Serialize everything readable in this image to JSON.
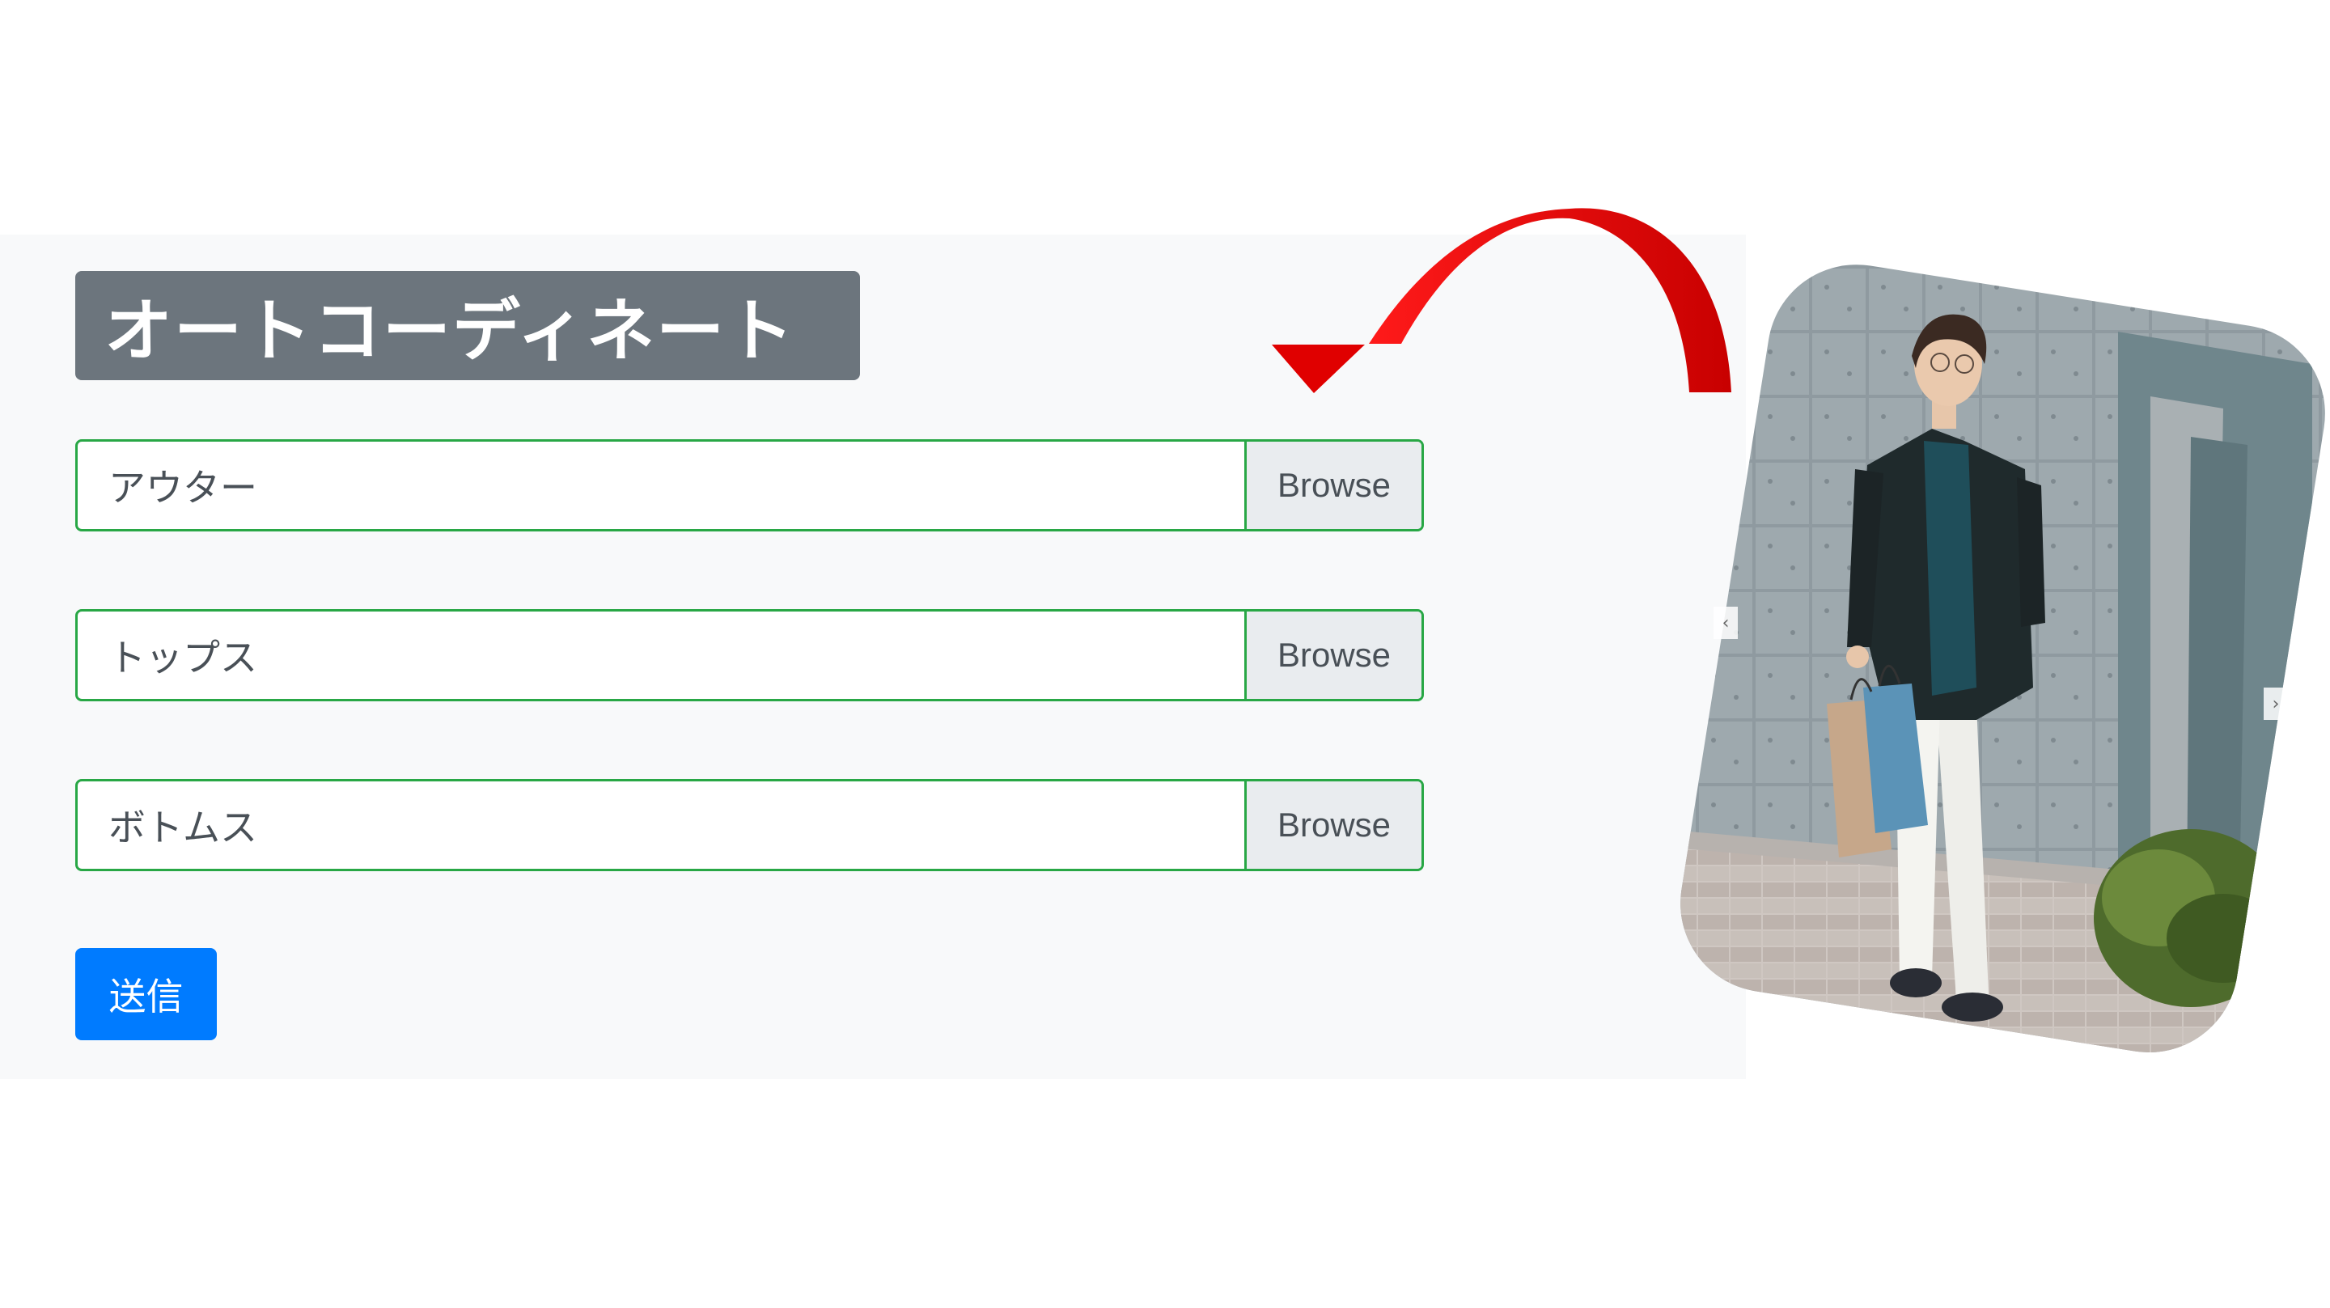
{
  "form": {
    "title": "オートコーディネート",
    "fields": [
      {
        "label": "アウター",
        "button": "Browse"
      },
      {
        "label": "トップス",
        "button": "Browse"
      },
      {
        "label": "ボトムス",
        "button": "Browse"
      }
    ],
    "submit_label": "送信"
  },
  "photo": {
    "prev_glyph": "‹",
    "next_glyph": "›"
  },
  "colors": {
    "panel_bg": "#f8f9fa",
    "title_bg": "#6c757d",
    "field_border": "#28a745",
    "browse_bg": "#e9ecef",
    "submit_bg": "#007bff",
    "arrow": "#e00000"
  },
  "icons": {
    "arrow": "curved-arrow-icon"
  }
}
